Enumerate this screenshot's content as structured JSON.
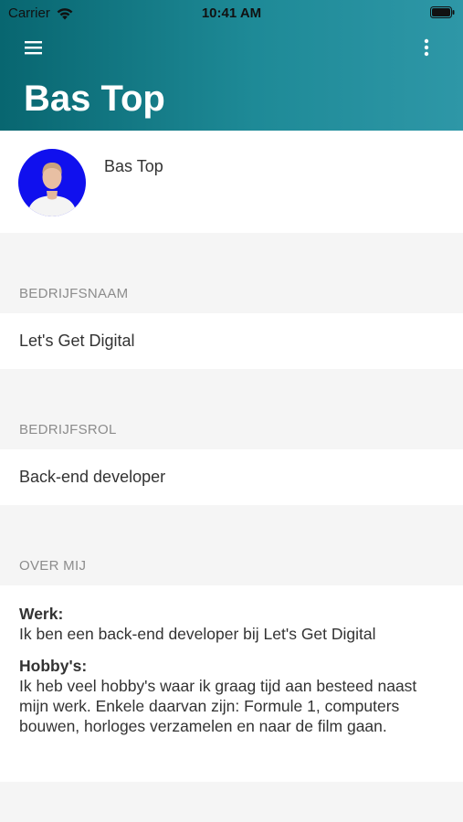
{
  "status_bar": {
    "carrier": "Carrier",
    "time": "10:41 AM"
  },
  "header": {
    "title": "Bas Top",
    "menu_icon": "hamburger-menu-icon",
    "more_icon": "more-vertical-icon",
    "gradient_from": "#086670",
    "gradient_to": "#2e97a7"
  },
  "profile": {
    "name": "Bas Top",
    "avatar_background": "#1010ee"
  },
  "sections": {
    "company_name": {
      "label": "BEDRIJFSNAAM",
      "value": "Let's Get Digital"
    },
    "company_role": {
      "label": "BEDRIJFSROL",
      "value": "Back-end developer"
    },
    "about": {
      "label": "OVER MIJ",
      "work_heading": "Werk:",
      "work_text": "Ik ben een back-end developer bij Let's Get Digital",
      "hobby_heading": "Hobby's:",
      "hobby_text": "Ik heb veel hobby's waar ik graag tijd aan besteed naast mijn werk. Enkele daarvan zijn: Formule 1, computers bouwen, horloges verzamelen en naar de film gaan."
    }
  }
}
